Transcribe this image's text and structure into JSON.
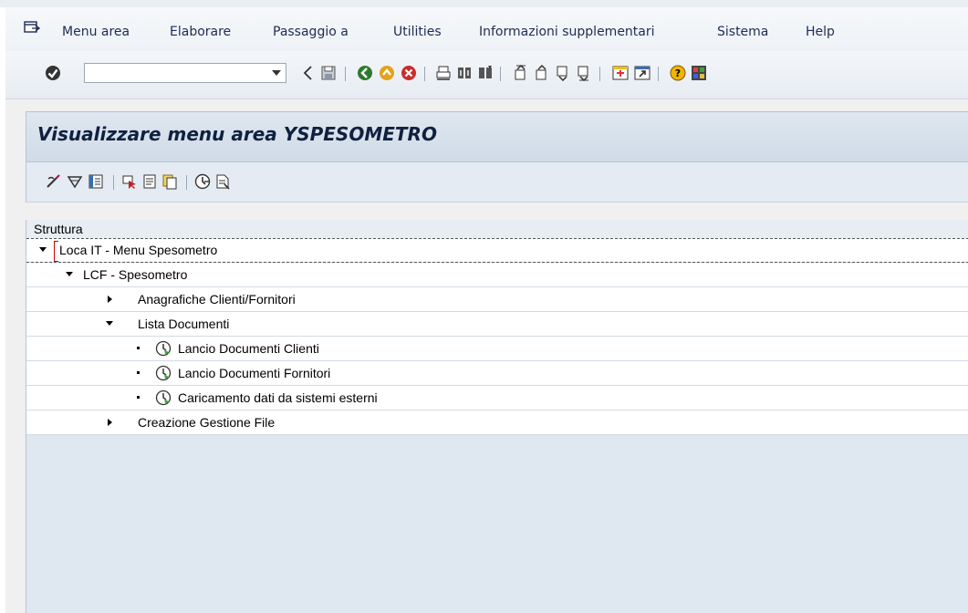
{
  "menubar": {
    "window_icon": "window-menu-icon",
    "items": [
      {
        "label": "Menu area"
      },
      {
        "label": "Elaborare"
      },
      {
        "label": "Passaggio a"
      },
      {
        "label": "Utilities"
      },
      {
        "label": "Informazioni supplementari"
      },
      {
        "label": "Sistema"
      },
      {
        "label": "Help"
      }
    ]
  },
  "toolbar": {
    "command_field": {
      "value": "",
      "placeholder": ""
    },
    "icons": [
      "enter-icon",
      "back-arrow-icon",
      "save-icon",
      "back-icon",
      "exit-icon",
      "cancel-icon",
      "print-icon",
      "find-icon",
      "find-next-icon",
      "first-page-icon",
      "previous-page-icon",
      "next-page-icon",
      "last-page-icon",
      "create-session-icon",
      "shortcut-icon",
      "help-icon",
      "customize-layout-icon"
    ]
  },
  "title": "Visualizzare menu area YSPESOMETRO",
  "app_toolbar": {
    "icons": [
      "change-icon",
      "expand-subtree-icon",
      "area-menu-icon",
      "select-icon",
      "display-icon",
      "copy-icon",
      "execute-icon",
      "documentation-icon"
    ]
  },
  "tree": {
    "header": "Struttura",
    "nodes": [
      {
        "label": "Loca IT - Menu Spesometro",
        "state": "expanded"
      },
      {
        "label": "LCF - Spesometro",
        "state": "expanded"
      },
      {
        "label": "Anagrafiche Clienti/Fornitori",
        "state": "collapsed"
      },
      {
        "label": "Lista Documenti",
        "state": "expanded"
      },
      {
        "label": "Lancio Documenti Clienti",
        "state": "leaf-transaction"
      },
      {
        "label": "Lancio Documenti Fornitori",
        "state": "leaf-transaction"
      },
      {
        "label": "Caricamento dati da sistemi esterni",
        "state": "leaf-transaction"
      },
      {
        "label": "Creazione Gestione File",
        "state": "collapsed"
      }
    ]
  },
  "colors": {
    "menu_text": "#1d2c55",
    "title_text": "#10203f",
    "tree_bg": "#dfe8f1",
    "row_bg": "#ffffff",
    "transaction_icon": "#3aa53a"
  }
}
